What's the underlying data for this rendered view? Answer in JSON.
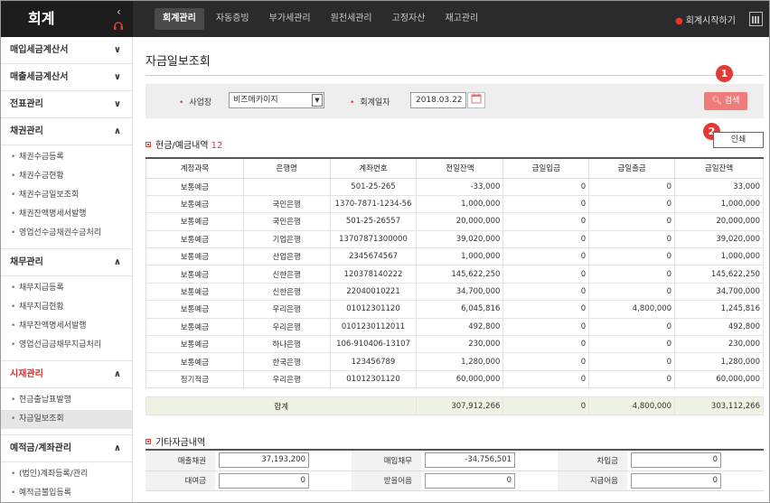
{
  "app": {
    "logo": "회계",
    "collapse_icon": "‹",
    "support_icon": "headset"
  },
  "nav": {
    "tabs": [
      "회계관리",
      "자동증빙",
      "부가세관리",
      "원천세관리",
      "고정자산",
      "재고관리"
    ],
    "active": 0,
    "start_label": "회계시작하기"
  },
  "sidebar": {
    "sections": [
      {
        "label": "매입세금계산서",
        "state": "collapsed",
        "items": []
      },
      {
        "label": "매출세금계산서",
        "state": "collapsed",
        "items": []
      },
      {
        "label": "전표관리",
        "state": "collapsed",
        "items": []
      },
      {
        "label": "채권관리",
        "state": "expanded",
        "items": [
          "채권수금등록",
          "채권수금현황",
          "채권수금일보조회",
          "채권잔액명세서발행",
          "영업선수금채권수금처리"
        ]
      },
      {
        "label": "채무관리",
        "state": "expanded",
        "items": [
          "채무지급등록",
          "채무지급현황",
          "채무잔액명세서발행",
          "영업선급금채무지급처리"
        ]
      },
      {
        "label": "시재관리",
        "state": "expanded",
        "highlight": true,
        "items": [
          "현금출납표발행",
          "자금일보조회"
        ],
        "active_item": 1
      },
      {
        "label": "예적금/계좌관리",
        "state": "expanded",
        "items": [
          "(법인)계좌등록/관리",
          "예적금불입등록"
        ]
      }
    ]
  },
  "page": {
    "title": "자금일보조회"
  },
  "search": {
    "biz_label": "사업장",
    "biz_value": "비즈메카이지",
    "date_label": "회계일자",
    "date_value": "2018.03.22",
    "button": "검색"
  },
  "badges": {
    "b1": "1",
    "b2": "2"
  },
  "section1": {
    "title": "현금/예금내역",
    "count": "12",
    "print": "인쇄"
  },
  "table": {
    "headers": [
      "계정과목",
      "은행명",
      "계좌번호",
      "전일잔액",
      "금일입금",
      "금일출금",
      "금일잔액"
    ],
    "rows": [
      [
        "보통예금",
        "",
        "501-25-265",
        "-33,000",
        "0",
        "0",
        "33,000"
      ],
      [
        "보통예금",
        "국민은행",
        "1370-7871-1234-56",
        "1,000,000",
        "0",
        "0",
        "1,000,000"
      ],
      [
        "보통예금",
        "국민은행",
        "501-25-26557",
        "20,000,000",
        "0",
        "0",
        "20,000,000"
      ],
      [
        "보통예금",
        "기업은행",
        "13707871300000",
        "39,020,000",
        "0",
        "0",
        "39,020,000"
      ],
      [
        "보통예금",
        "산업은행",
        "2345674567",
        "1,000,000",
        "0",
        "0",
        "1,000,000"
      ],
      [
        "보통예금",
        "신한은행",
        "120378140222",
        "145,622,250",
        "0",
        "0",
        "145,622,250"
      ],
      [
        "보통예금",
        "신한은행",
        "22040010221",
        "34,700,000",
        "0",
        "0",
        "34,700,000"
      ],
      [
        "보통예금",
        "우리은행",
        "01012301120",
        "6,045,816",
        "0",
        "4,800,000",
        "1,245,816"
      ],
      [
        "보통예금",
        "우리은행",
        "0101230112011",
        "492,800",
        "0",
        "0",
        "492,800"
      ],
      [
        "보통예금",
        "하나은행",
        "106-910406-13107",
        "230,000",
        "0",
        "0",
        "230,000"
      ],
      [
        "보통예금",
        "한국은행",
        "123456789",
        "1,280,000",
        "0",
        "0",
        "1,280,000"
      ],
      [
        "정기적금",
        "우리은행",
        "01012301120",
        "60,000,000",
        "0",
        "0",
        "60,000,000"
      ]
    ],
    "total": {
      "label": "합계",
      "prev": "307,912,266",
      "in": "0",
      "out": "4,800,000",
      "bal": "303,112,266"
    }
  },
  "section2": {
    "title": "기타자금내역",
    "rows": [
      [
        {
          "label": "매출채권",
          "value": "37,193,200"
        },
        {
          "label": "매입채무",
          "value": "-34,756,501"
        },
        {
          "label": "차입금",
          "value": "0"
        }
      ],
      [
        {
          "label": "대여금",
          "value": "0"
        },
        {
          "label": "받을어음",
          "value": "0"
        },
        {
          "label": "지급어음",
          "value": "0"
        }
      ]
    ]
  }
}
